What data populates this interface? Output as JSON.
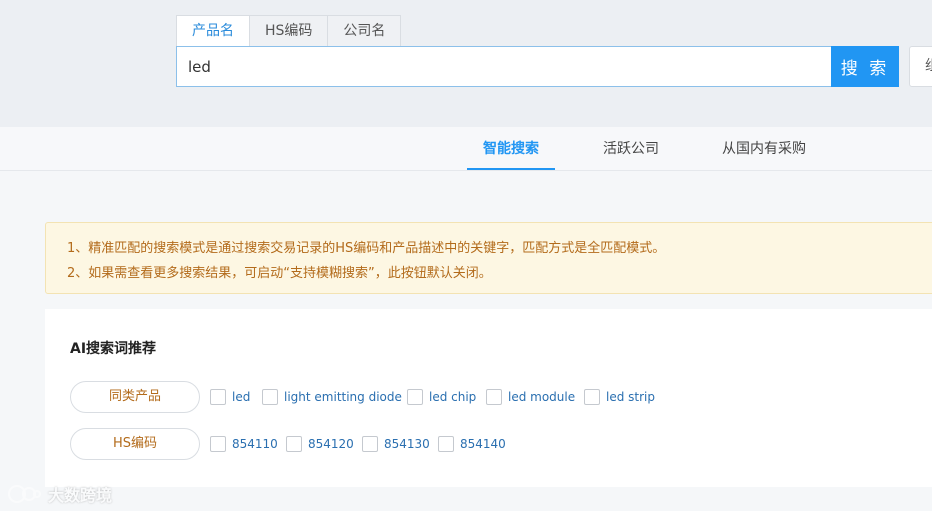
{
  "search": {
    "tabs": [
      "产品名",
      "HS编码",
      "公司名"
    ],
    "active_tab": 0,
    "query": "led",
    "button_label": "搜 索",
    "side_button_label": "组"
  },
  "nav": {
    "tabs": [
      "智能搜索",
      "活跃公司",
      "从国内有采购"
    ],
    "active_tab": 0
  },
  "notice": {
    "lines": [
      "1、精准匹配的搜索模式是通过搜索交易记录的HS编码和产品描述中的关键字，匹配方式是全匹配模式。",
      "2、如果需查看更多搜索结果，可启动“支持模糊搜索”，此按钮默认关闭。"
    ]
  },
  "ai": {
    "title": "AI搜索词推荐",
    "rows": [
      {
        "label": "同类产品",
        "items": [
          "led",
          "light emitting diode",
          "led chip",
          "led module",
          "led strip"
        ]
      },
      {
        "label": "HS编码",
        "items": [
          "854110",
          "854120",
          "854130",
          "854140"
        ]
      }
    ]
  },
  "watermark": {
    "text": "大数跨境"
  },
  "colors": {
    "accent": "#2196f3",
    "notice_text": "#b36b1b",
    "notice_bg": "#fdf7e3",
    "label_text": "#b36b1b",
    "link": "#2a6fb0"
  }
}
